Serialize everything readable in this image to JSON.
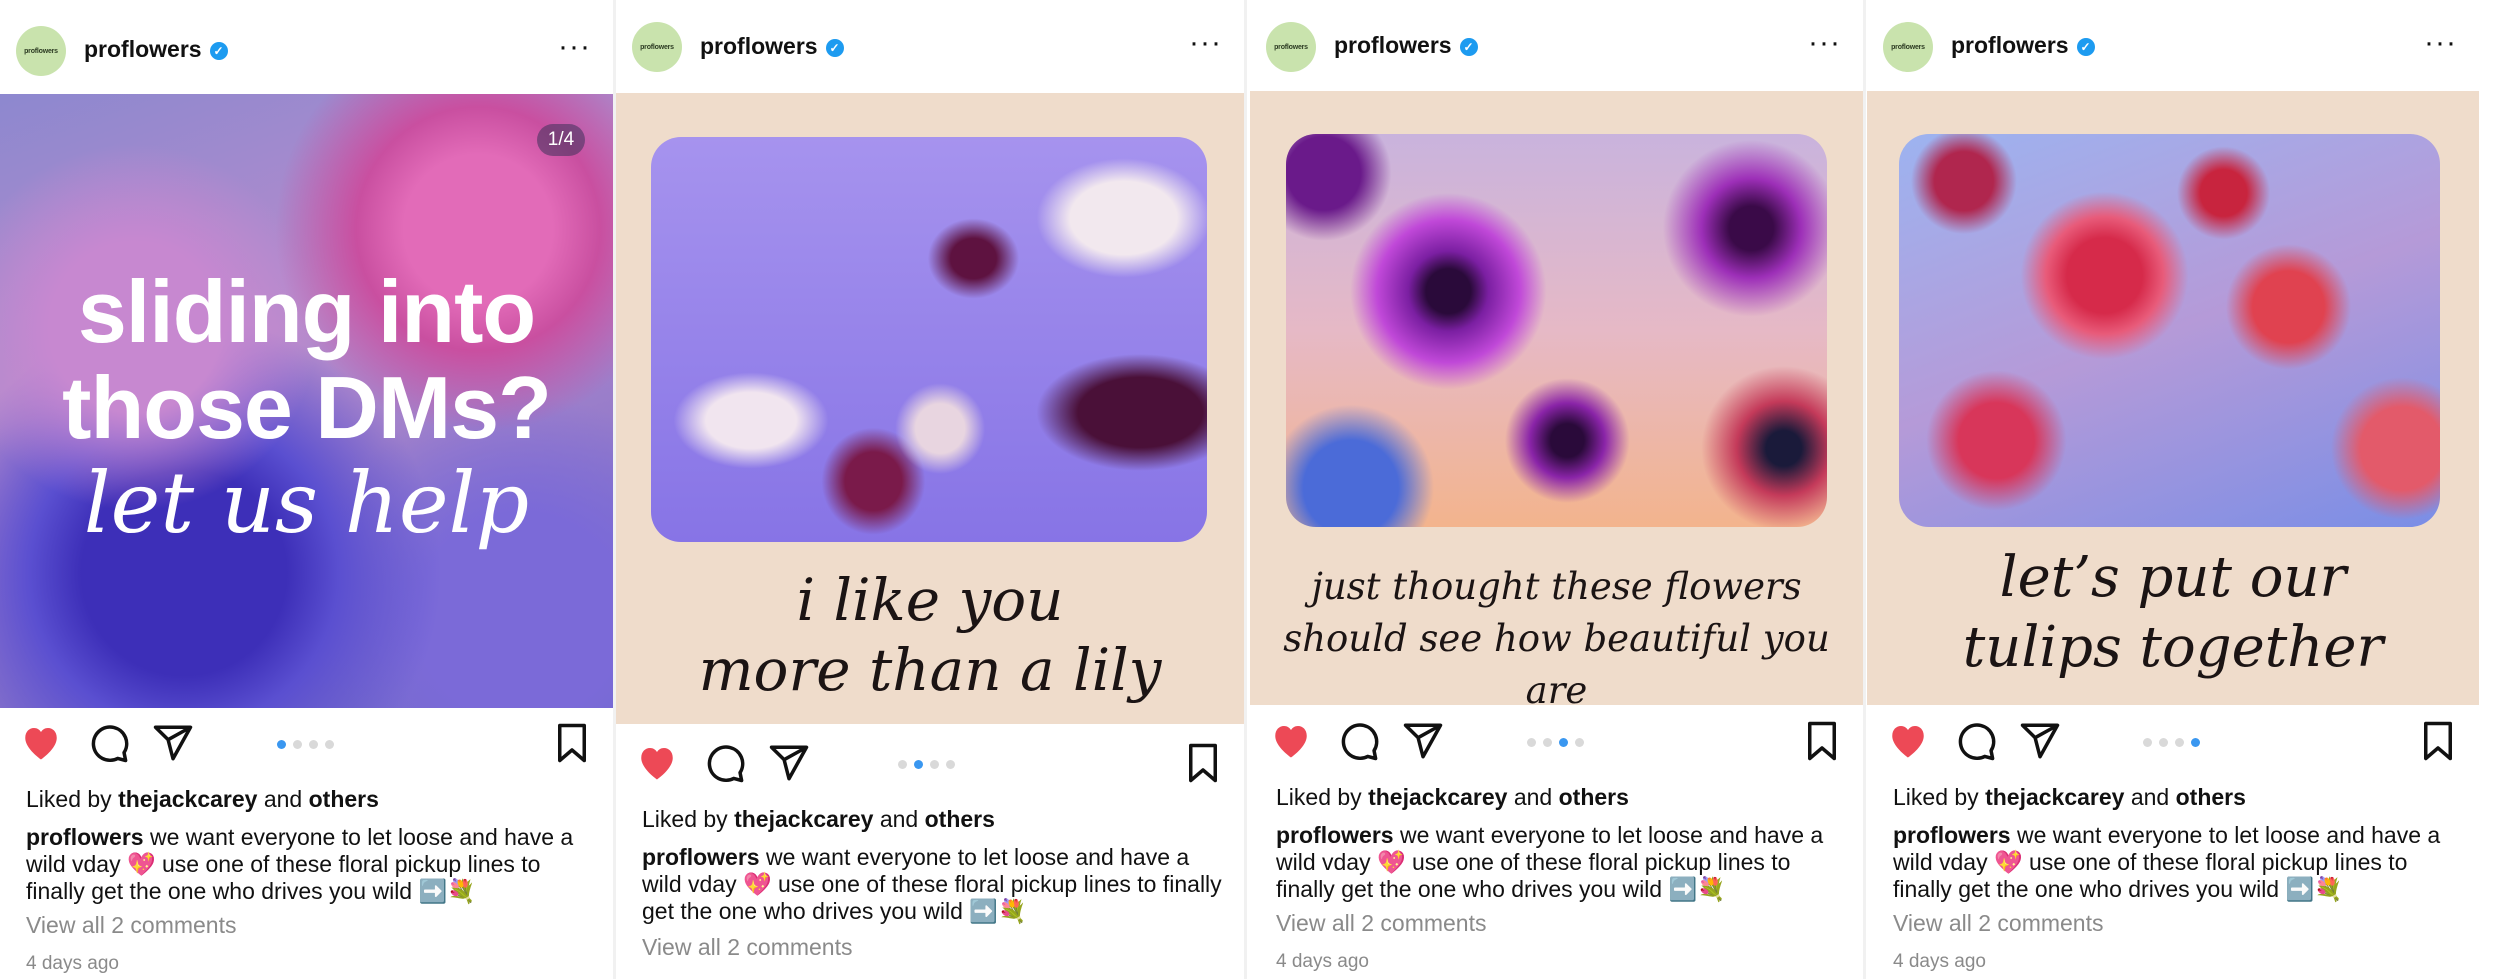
{
  "posts": [
    {
      "username": "proflowers",
      "avatar_text": "proflowers",
      "counter": "1/4",
      "slide_title": "sliding into those DMs?",
      "slide_subtitle": "let us help",
      "liked_prefix": "Liked by",
      "liked_user": "thejackcarey",
      "liked_and": "and",
      "liked_others": "others",
      "caption_user": "proflowers",
      "caption_text": "we want everyone to let loose and have a wild vday 💖 use one of these floral pickup lines to finally get the one who drives you wild ➡️💐",
      "view_comments": "View all 2 comments",
      "timestamp": "4 days ago",
      "active_dot": 1
    },
    {
      "username": "proflowers",
      "avatar_text": "proflowers",
      "quote_line1": "i like you",
      "quote_line2": "more than a lily",
      "liked_prefix": "Liked by",
      "liked_user": "thejackcarey",
      "liked_and": "and",
      "liked_others": "others",
      "caption_user": "proflowers",
      "caption_text": "we want everyone to let loose and have a wild vday 💖 use one of these floral pickup lines to finally get the one who drives you wild ➡️💐",
      "view_comments": "View all 2 comments",
      "active_dot": 2
    },
    {
      "username": "proflowers",
      "avatar_text": "proflowers",
      "quote_line1": "just thought these flowers",
      "quote_line2": "should see how beautiful you are",
      "liked_prefix": "Liked by",
      "liked_user": "thejackcarey",
      "liked_and": "and",
      "liked_others": "others",
      "caption_user": "proflowers",
      "caption_text": "we want everyone to let loose and have a wild vday 💖 use one of these floral pickup lines to finally get the one who drives you wild ➡️💐",
      "view_comments": "View all 2 comments",
      "timestamp": "4 days ago",
      "active_dot": 3
    },
    {
      "username": "proflowers",
      "avatar_text": "proflowers",
      "quote_line1": "let’s put our",
      "quote_line2": "tulips together",
      "liked_prefix": "Liked by",
      "liked_user": "thejackcarey",
      "liked_and": "and",
      "liked_others": "others",
      "caption_user": "proflowers",
      "caption_text": "we want everyone to let loose and have a wild vday 💖 use one of these floral pickup lines to finally get the one who drives you wild ➡️💐",
      "view_comments": "View all 2 comments",
      "timestamp": "4 days ago",
      "active_dot": 4
    }
  ],
  "icons": {
    "like": "heart-icon",
    "comment": "comment-icon",
    "share": "share-icon",
    "save": "bookmark-icon",
    "more": "more-icon",
    "verified": "verified-icon"
  },
  "colors": {
    "heart": "#ed4956",
    "verified": "#1d9bf0",
    "dot_active": "#3a97f0",
    "cream": "#efdccb"
  }
}
